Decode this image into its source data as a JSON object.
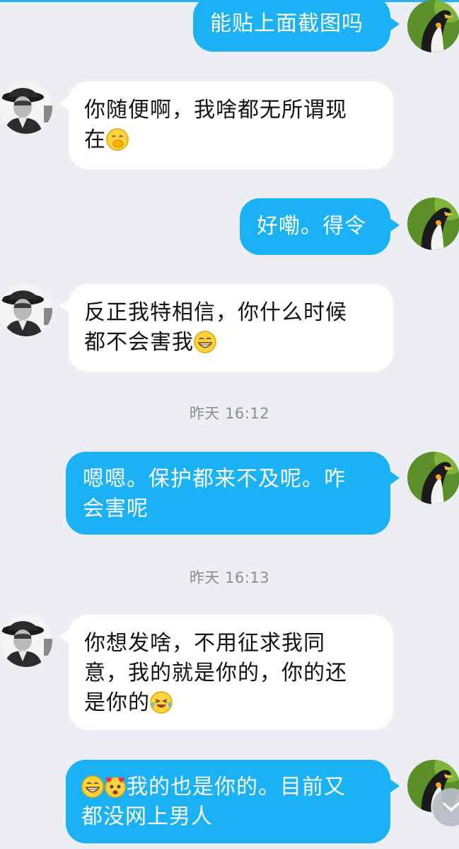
{
  "colors": {
    "background": "#eceef3",
    "outgoing_bubble": "#1ab2f5",
    "incoming_bubble": "#ffffff",
    "timestamp_text": "#8a8d93"
  },
  "messages": [
    {
      "id": "m1",
      "sender": "self",
      "text": "能贴上面截图吗"
    },
    {
      "id": "m2",
      "sender": "other",
      "text_line1": "你随便啊，我啥都无所谓现",
      "text_line2": "在",
      "emoji": "covering-mouth-laugh-emoji"
    },
    {
      "id": "m3",
      "sender": "self",
      "text": "好嘞。得令"
    },
    {
      "id": "m4",
      "sender": "other",
      "text_line1": "反正我特相信，你什么时候",
      "text_line2": "都不会害我",
      "emoji": "grinning-emoji"
    },
    {
      "id": "m5",
      "sender": "self",
      "text_line1": "嗯嗯。保护都来不及呢。咋",
      "text_line2": "会害呢"
    },
    {
      "id": "m6",
      "sender": "other",
      "text_line1": "你想发啥，不用征求我同",
      "text_line2": "意，我的就是你的，你的还",
      "text_line3": "是你的",
      "emoji": "crying-laughing-emoji"
    },
    {
      "id": "m7",
      "sender": "self",
      "text_line1": "我的也是你的。目前又",
      "text_line2": "都没网上男人",
      "emojis": [
        "grinning-emoji",
        "heart-eyes-emoji"
      ]
    }
  ],
  "timestamps": [
    {
      "label": "昨天 16:12"
    },
    {
      "label": "昨天 16:13"
    }
  ],
  "icons": {
    "self_avatar": "penguin-avatar",
    "other_avatar": "man-in-hat-avatar",
    "scroll": "chevron-down-icon"
  }
}
